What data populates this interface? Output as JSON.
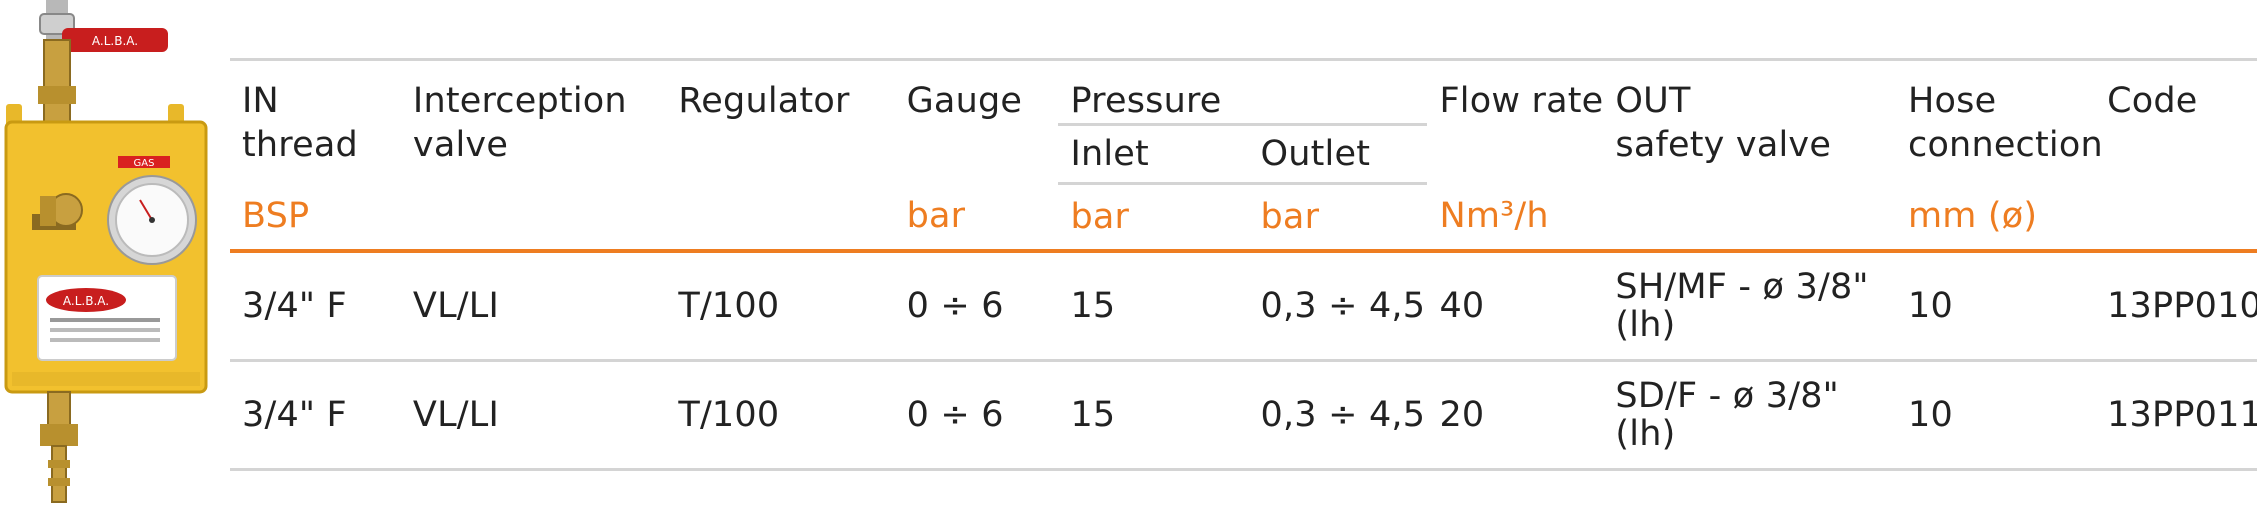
{
  "headers": {
    "in_thread": "IN\nthread",
    "interception_valve": "Interception\nvalve",
    "regulator": "Regulator",
    "gauge": "Gauge",
    "pressure": "Pressure",
    "inlet": "Inlet",
    "outlet": "Outlet",
    "flow_rate": "Flow rate",
    "out_safety_valve": "OUT\nsafety valve",
    "hose_connection": "Hose\nconnection",
    "code": "Code"
  },
  "units": {
    "in_thread": "BSP",
    "gauge": "bar",
    "inlet": "bar",
    "outlet": "bar",
    "flow_rate": "Nm³/h",
    "hose_connection": "mm (ø)"
  },
  "rows": [
    {
      "in_thread": "3/4\" F",
      "interception_valve": "VL/LI",
      "regulator": "T/100",
      "gauge": "0 ÷ 6",
      "inlet": "15",
      "outlet": "0,3 ÷ 4,5",
      "flow_rate": "40",
      "out_safety_valve": "SH/MF - ø 3/8\"\n(lh)",
      "hose_connection": "10",
      "code": "13PP010"
    },
    {
      "in_thread": "3/4\" F",
      "interception_valve": "VL/LI",
      "regulator": "T/100",
      "gauge": "0 ÷ 6",
      "inlet": "15",
      "outlet": "0,3 ÷ 4,5",
      "flow_rate": "20",
      "out_safety_valve": "SD/F - ø 3/8\"\n(lh)",
      "hose_connection": "10",
      "code": "13PP011"
    }
  ],
  "product_image": {
    "valve_tag": "A.L.B.A.",
    "box_label": "GAS",
    "plate_brand": "A.L.B.A."
  },
  "colors": {
    "accent_orange": "#ee7d21",
    "rule_gray": "#d4d4d4",
    "box_yellow": "#f2c12e"
  }
}
